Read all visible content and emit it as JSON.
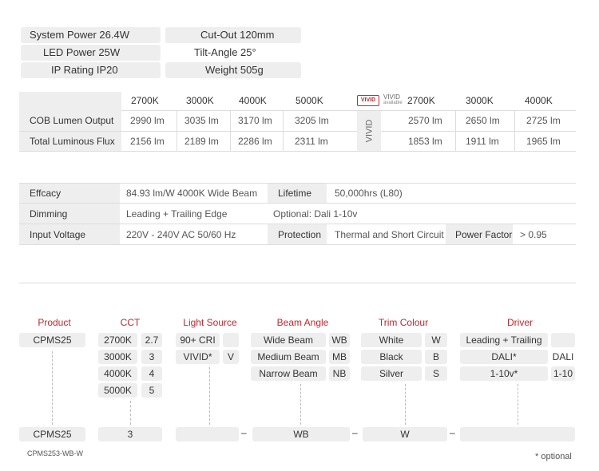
{
  "specs": {
    "system_power": "System Power  26.4W",
    "led_power": "LED Power  25W",
    "ip_rating": "IP Rating  IP20",
    "cut_out": "Cut-Out  120mm",
    "tilt_angle": "Tilt-Angle 25°",
    "weight": "Weight  505g"
  },
  "lumen": {
    "cct_headers": [
      "2700K",
      "3000K",
      "4000K",
      "5000K"
    ],
    "vivid_badge": "VIVID",
    "vivid_label": "VIVID",
    "vivid_sub": "available",
    "vivid_side": "VIVID",
    "vivid_headers": [
      "2700K",
      "3000K",
      "4000K"
    ],
    "rows": [
      {
        "label": "COB Lumen Output",
        "values": [
          "2990 lm",
          "3035 lm",
          "3170 lm",
          "3205 lm"
        ],
        "vivid": [
          "2570 lm",
          "2650 lm",
          "2725 lm"
        ]
      },
      {
        "label": "Total Luminous Flux",
        "values": [
          "2156 lm",
          "2189 lm",
          "2286 lm",
          "2311 lm"
        ],
        "vivid": [
          "1853 lm",
          "1911 lm",
          "1965 lm"
        ]
      }
    ]
  },
  "details": {
    "efficacy_label": "Effcacy",
    "efficacy_value": "84.93 lm/W   4000K Wide Beam",
    "lifetime_label": "Lifetime",
    "lifetime_value": "50,000hrs (L80)",
    "dimming_label": "Dimming",
    "dimming_value": "Leading + Trailing Edge",
    "dimming_optional": "Optional:  Dali   1-10v",
    "input_label": "Input Voltage",
    "input_value": "220V - 240V AC   50/60 Hz",
    "protection_label": "Protection",
    "protection_value": "Thermal and Short Circuit",
    "pf_label": "Power Factor",
    "pf_value": "> 0.95"
  },
  "ordering": {
    "headers": {
      "product": "Product",
      "cct": "CCT",
      "light_source": "Light Source",
      "beam_angle": "Beam Angle",
      "trim_colour": "Trim Colour",
      "driver": "Driver"
    },
    "product": [
      "CPMS25"
    ],
    "cct": [
      [
        "2700K",
        "2.7"
      ],
      [
        "3000K",
        "3"
      ],
      [
        "4000K",
        "4"
      ],
      [
        "5000K",
        "5"
      ]
    ],
    "light_source": [
      [
        "90+ CRI",
        ""
      ],
      [
        "VIVID*",
        "V"
      ]
    ],
    "beam_angle": [
      [
        "Wide Beam",
        "WB"
      ],
      [
        "Medium Beam",
        "MB"
      ],
      [
        "Narrow Beam",
        "NB"
      ]
    ],
    "trim_colour": [
      [
        "White",
        "W"
      ],
      [
        "Black",
        "B"
      ],
      [
        "Silver",
        "S"
      ]
    ],
    "driver": [
      [
        "Leading + Trailing",
        ""
      ],
      [
        "DALI*",
        "DALI"
      ],
      [
        "1-10v*",
        "1-10"
      ]
    ],
    "result": {
      "product": "CPMS25",
      "cct": "3",
      "light_source": "",
      "beam": "WB",
      "trim": "W",
      "driver": "",
      "dash": "–"
    },
    "example": "CPMS253-WB-W",
    "optional_note": "* optional"
  }
}
